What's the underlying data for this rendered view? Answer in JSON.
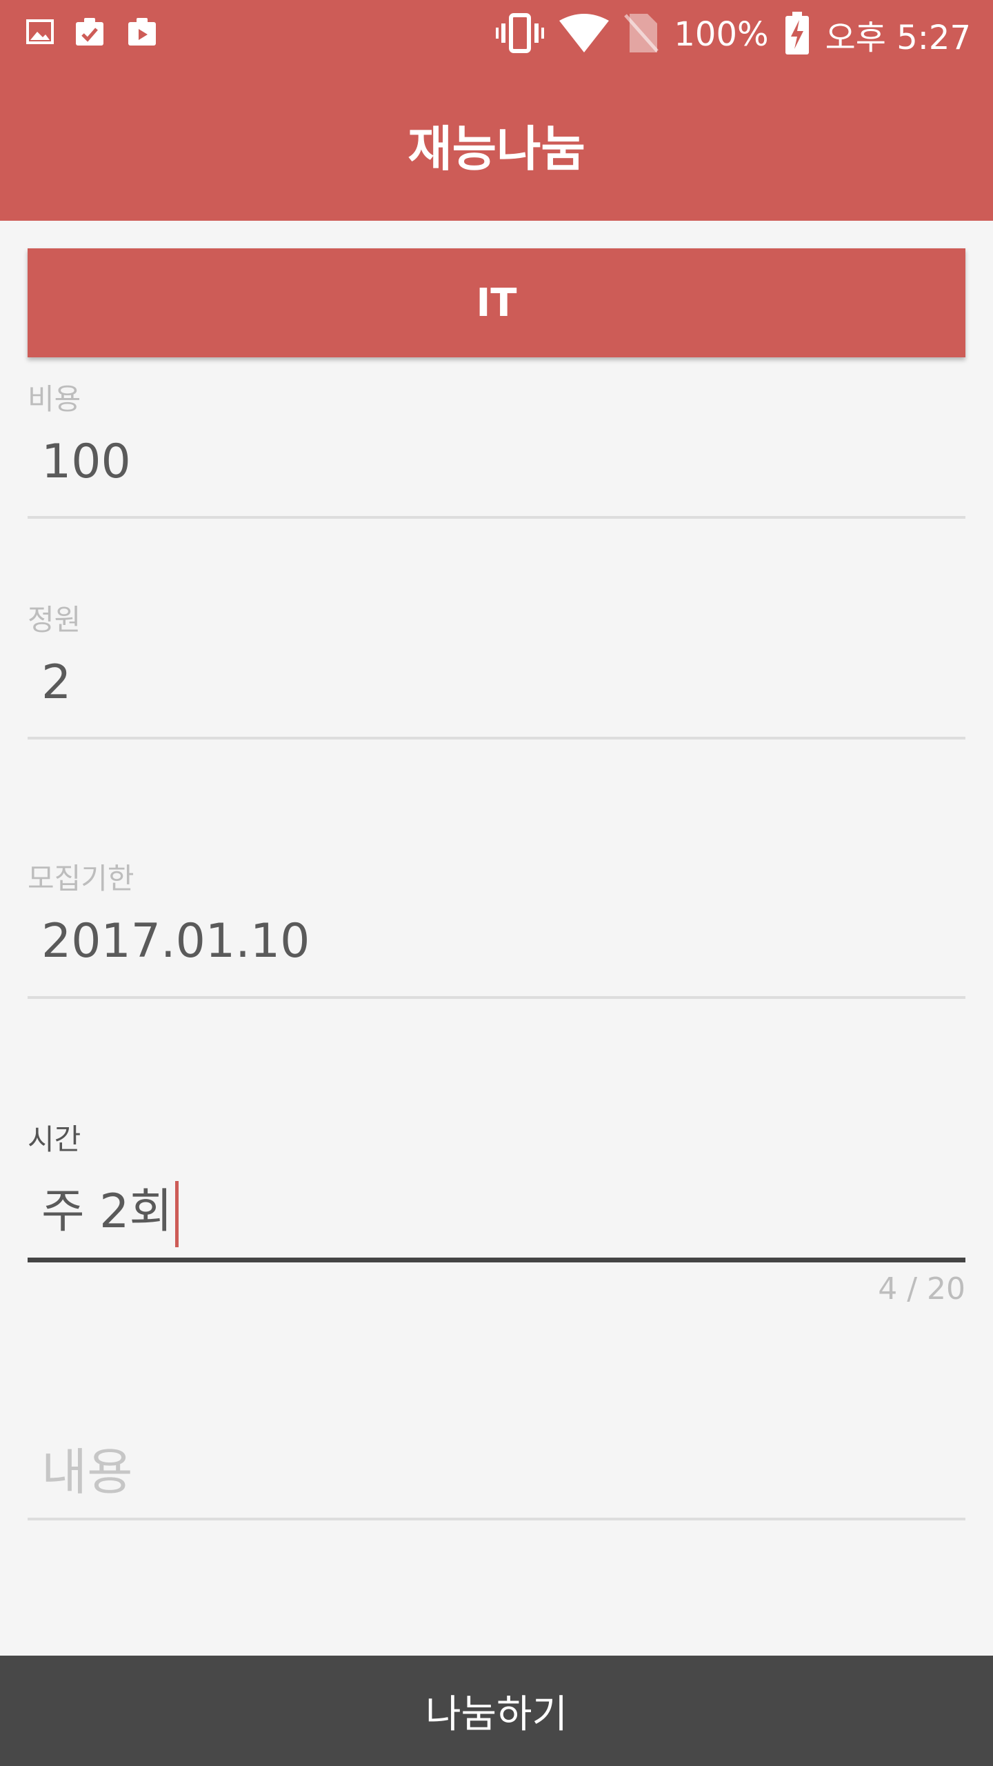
{
  "status_bar": {
    "battery": "100%",
    "time": "오후 5:27",
    "icons": [
      "gallery-icon",
      "clipboard-check-icon",
      "clipboard-play-icon",
      "vibrate-icon",
      "wifi-icon",
      "no-sim-icon",
      "battery-charging-icon"
    ]
  },
  "toolbar": {
    "title": "재능나눔"
  },
  "category_button": {
    "label": "IT"
  },
  "form": {
    "cost": {
      "label": "비용",
      "value": "100"
    },
    "capacity": {
      "label": "정원",
      "value": "2"
    },
    "deadline": {
      "label": "모집기한",
      "value": "2017.01.10"
    },
    "time": {
      "label": "시간",
      "value": "주 2회",
      "counter": "4 / 20"
    },
    "content": {
      "placeholder": "내용"
    }
  },
  "submit_button": {
    "label": "나눔하기"
  },
  "colors": {
    "accent": "#cd5c57",
    "bottom_bar": "#484848",
    "background": "#f5f5f5"
  }
}
